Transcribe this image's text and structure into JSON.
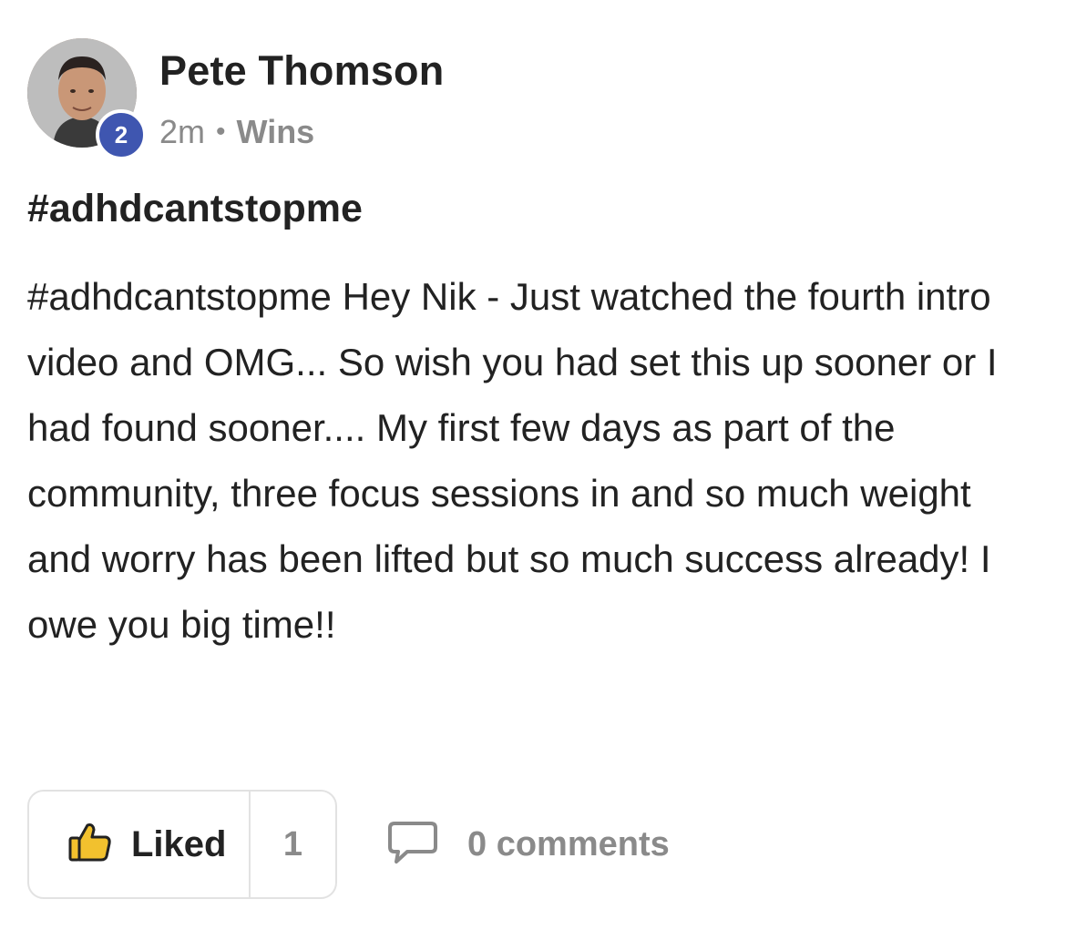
{
  "author": {
    "name": "Pete Thomson",
    "level": "2",
    "time": "2m",
    "separator": "•",
    "category": "Wins"
  },
  "post": {
    "title": "#adhdcantstopme",
    "body": "#adhdcantstopme Hey Nik - Just watched the fourth intro video and OMG... So wish you had set this up sooner or I had found sooner.... My first few days as part of the community, three focus sessions in and so much weight and worry has been lifted but so much success already! I owe you big time!!"
  },
  "actions": {
    "like_label": "Liked",
    "like_count": "1",
    "comments_label": "0 comments"
  },
  "colors": {
    "badge": "#3f56b0",
    "like_icon_fill": "#f2c12e",
    "muted_text": "#8a8a8a"
  },
  "icons": {
    "like": "thumbs-up-icon",
    "comment": "comment-bubble-icon"
  }
}
